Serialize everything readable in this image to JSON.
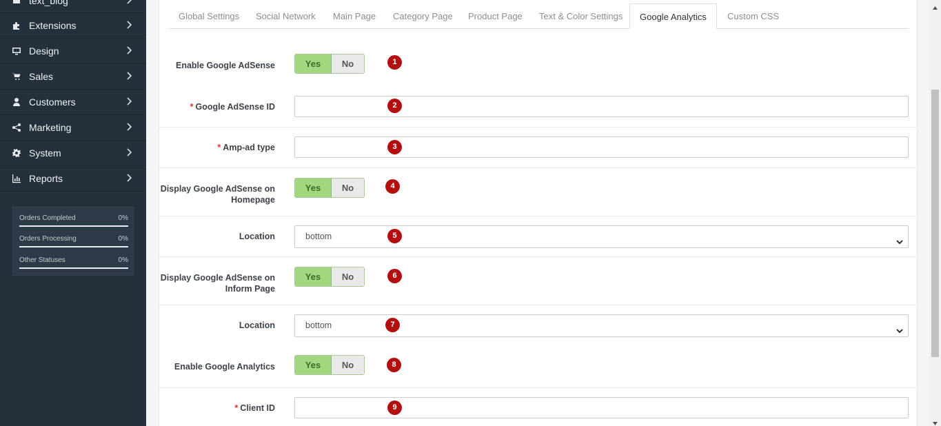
{
  "sidebar": {
    "items": [
      {
        "label": "text_blog",
        "icon": "blog-icon"
      },
      {
        "label": "Extensions",
        "icon": "puzzle-icon"
      },
      {
        "label": "Design",
        "icon": "monitor-icon"
      },
      {
        "label": "Sales",
        "icon": "cart-icon"
      },
      {
        "label": "Customers",
        "icon": "user-icon"
      },
      {
        "label": "Marketing",
        "icon": "share-icon"
      },
      {
        "label": "System",
        "icon": "gear-icon"
      },
      {
        "label": "Reports",
        "icon": "bar-chart-icon"
      }
    ],
    "stats": [
      {
        "label": "Orders Completed",
        "percent": "0%",
        "value": 0
      },
      {
        "label": "Orders Processing",
        "percent": "0%",
        "value": 0
      },
      {
        "label": "Other Statuses",
        "percent": "0%",
        "value": 0
      }
    ]
  },
  "tabs": [
    {
      "label": "Global Settings",
      "active": false
    },
    {
      "label": "Social Network",
      "active": false
    },
    {
      "label": "Main Page",
      "active": false
    },
    {
      "label": "Category Page",
      "active": false
    },
    {
      "label": "Product Page",
      "active": false
    },
    {
      "label": "Text & Color Settings",
      "active": false
    },
    {
      "label": "Google Analytics",
      "active": true
    },
    {
      "label": "Custom CSS",
      "active": false
    }
  ],
  "form": {
    "yes_label": "Yes",
    "no_label": "No",
    "required_mark": "*",
    "enable_adsense": {
      "label": "Enable Google AdSense",
      "value": "Yes",
      "badge": "1"
    },
    "adsense_id": {
      "label": "Google AdSense ID",
      "value": "",
      "badge": "2"
    },
    "amp_ad_type": {
      "label": "Amp-ad type",
      "value": "",
      "badge": "3"
    },
    "display_homepage": {
      "label": "Display Google AdSense on Homepage",
      "value": "Yes",
      "badge": "4"
    },
    "location_home": {
      "label": "Location",
      "value": "bottom",
      "badge": "5"
    },
    "display_inform": {
      "label": "Display Google AdSense on Inform Page",
      "value": "Yes",
      "badge": "6"
    },
    "location_inform": {
      "label": "Location",
      "value": "bottom",
      "badge": "7"
    },
    "enable_analytics": {
      "label": "Enable Google Analytics",
      "value": "Yes",
      "badge": "8"
    },
    "client_id": {
      "label": "Client ID",
      "value": "",
      "badge": "9"
    }
  },
  "colors": {
    "sidebar_bg": "#24303c",
    "toggle_yes": "#a3d77f",
    "badge": "#b30f0f",
    "required": "#d9332b"
  }
}
